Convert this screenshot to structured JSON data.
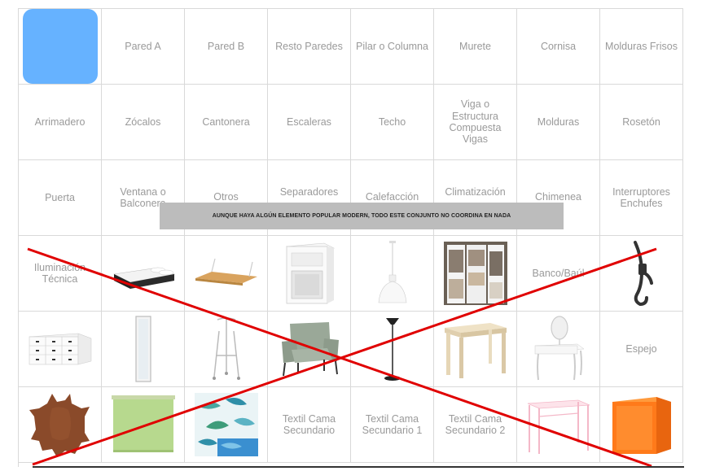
{
  "grid": {
    "r1": [
      "",
      "Pared A",
      "Pared B",
      "Resto Paredes",
      "Pilar o Columna",
      "Murete",
      "Cornisa",
      "Molduras Frisos"
    ],
    "r2": [
      "Arrimadero",
      "Zócalos",
      "Cantonera",
      "Escaleras",
      "Techo",
      "Viga o Estructura Compuesta Vigas",
      "Molduras",
      "Rosetón"
    ],
    "r3": [
      "Puerta",
      "Ventana o Balconera",
      "Otros",
      "Separadores",
      "Calefacción",
      "Climatización",
      "Chimenea",
      "Interruptores Enchufes"
    ],
    "r4_text": {
      "c1": "Iluminación Técnica",
      "c7": "Banco/Baúl"
    },
    "r5_text": {
      "c8": "Espejo"
    },
    "r6_text": {
      "c4": "Textil Cama Secundario",
      "c5": "Textil Cama Secundario 1",
      "c6": "Textil Cama Secundario 2"
    }
  },
  "banner": "AUNQUE HAYA ALGÚN ELEMENTO POPULAR MODERN, TODO ESTE CONJUNTO NO COORDINA EN NADA",
  "colors": {
    "swatch": "#66b2ff",
    "cross": "#e00000",
    "banner_bg": "#bcbcbc"
  },
  "icons": [
    "bed-image",
    "shelf-image",
    "nightstand-image",
    "pendant-lamp-image",
    "wardrobe-image",
    "hook-image",
    "dresser-image",
    "mirror-image",
    "valet-stand-image",
    "armchair-image",
    "floor-lamp-image",
    "side-table-image",
    "vanity-image",
    "cowhide-rug-image",
    "roller-blind-image",
    "tropical-bedding-image",
    "pink-desk-image",
    "orange-cube-image"
  ]
}
